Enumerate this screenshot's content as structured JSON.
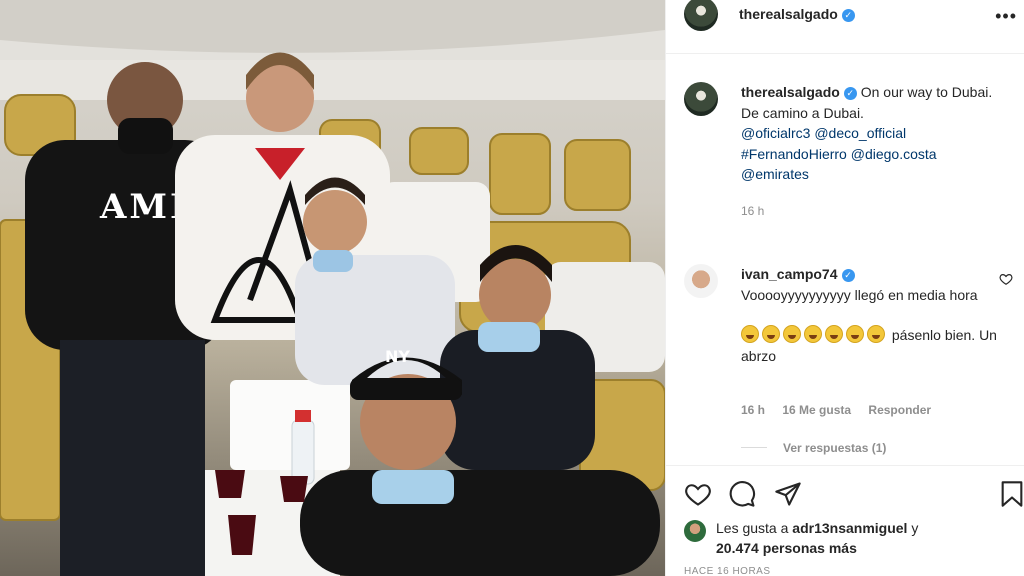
{
  "post": {
    "author": "therealsalgado",
    "author_verified": true,
    "caption": {
      "username": "therealsalgado",
      "line1": "On our way to Dubai.",
      "line2": "De camino a Dubai.",
      "mentions": [
        "@oficialrc3",
        "@deco_official",
        "#FernandoHierro",
        "@diego.costa",
        "@emirates"
      ],
      "time": "16 h"
    },
    "comment": {
      "username": "ivan_campo74",
      "text1": "Vooooyyyyyyyyyy llegó en media hora",
      "text2": "pásenlo bien. Un abrzo",
      "emoji_count": 7,
      "time": "16 h",
      "likes": "16 Me gusta",
      "reply_label": "Responder",
      "view_replies": "Ver respuestas (1)"
    },
    "likes": {
      "prefix": "Les gusta a",
      "liker": "adr13nsanmiguel",
      "joiner": "y",
      "others": "20.474 personas más"
    },
    "posted_ago": "HACE 16 HORAS"
  },
  "photo": {
    "shirt_text": "AMIRI",
    "cap_logo": "NY"
  },
  "colors": {
    "link": "#00376b",
    "verified": "#3897f0",
    "muted": "#8e8e8e",
    "border": "#efefef"
  },
  "icons": [
    "more-icon",
    "verified-icon",
    "heart-icon",
    "comment-icon",
    "share-icon",
    "bookmark-icon"
  ]
}
